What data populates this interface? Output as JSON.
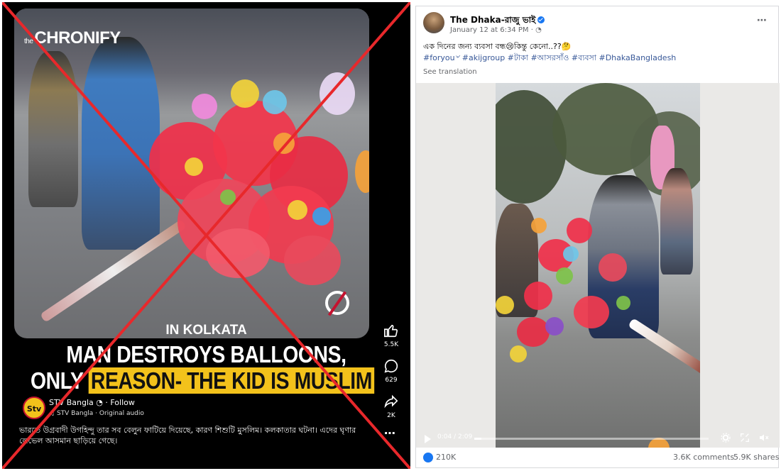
{
  "left_panel": {
    "brand_prefix": "the",
    "brand": "CHRONIFY",
    "place": "IN KOLKATA",
    "headline_line1": "MAN DESTROYS BALLOONS,",
    "headline_line2_start": "ONLY ",
    "headline_line2_highlight": "REASON- THE KID IS MUSLIM",
    "rail": {
      "likes": "5.5K",
      "comments": "629",
      "shares": "2K"
    },
    "account": {
      "avatar_text": "Stv",
      "name": "STV Bangla",
      "follow": "· Follow",
      "audio": "STV Bangla · Original audio"
    },
    "caption": "ভারতে উগ্রবাদী উগহিন্দু তার সব বেলুন ফাটিয়ে দিয়েছে, কারণ শিশুটি মুসলিম। কলকাতার ঘটনা। এদের ঘৃণার লেভেল আসমান ছাড়িয়ে গেছে।",
    "cross_color": "#e8282b",
    "highlight_color": "#f3c21b"
  },
  "right_panel": {
    "page_name": "The Dhaka-রাজু ভাই",
    "date": "January 12 at 6:34 PM ·",
    "post_text": "এক দিনের জন্য ব্যবসা বন্ধ😢কিন্তু কেনো..??🤔",
    "hashtags": "#foryou৺ #akijgroup #টাকা #আসরসাঁও #ব্যবসা #DhakaBangladesh",
    "see_translation": "See translation",
    "video": {
      "time": "0:04 / 2:09",
      "progress": 0.03
    },
    "reactions": "210K",
    "comments": "3.6K comments",
    "shares": "5.9K shares",
    "accent": "#1877f2"
  }
}
